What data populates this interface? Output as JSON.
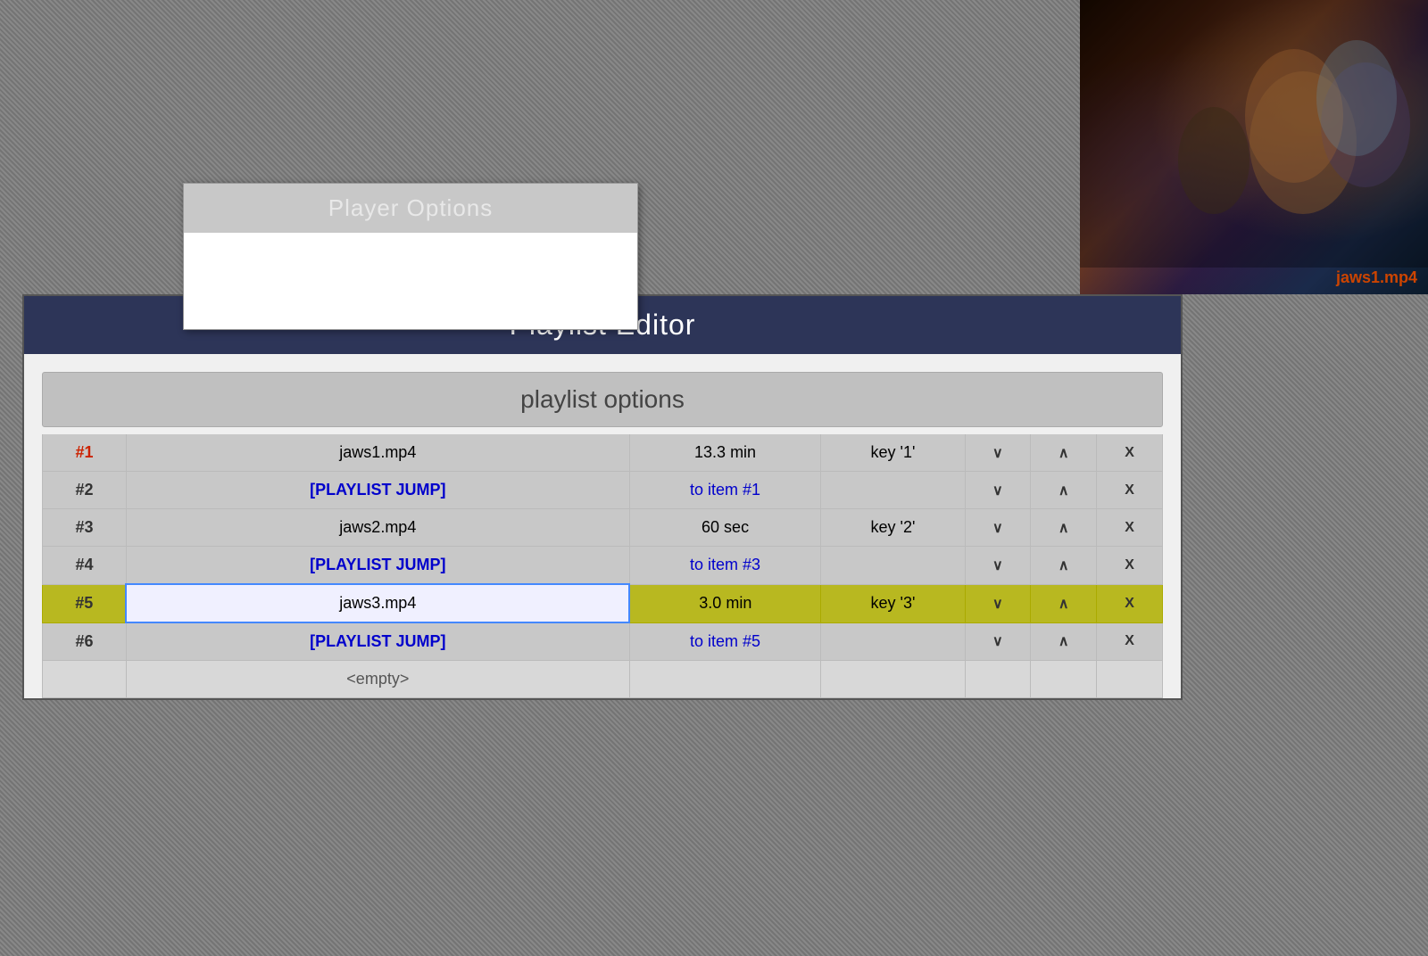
{
  "player_options": {
    "title": "Player Options"
  },
  "video_thumbnail": {
    "filename": "jaws1.mp4"
  },
  "playlist_editor": {
    "title": "Playlist Editor",
    "options_bar_label": "playlist options",
    "rows": [
      {
        "num": "#1",
        "num_class": "current",
        "filename": "jaws1.mp4",
        "filename_type": "normal",
        "duration": "13.3 min",
        "key": "key '1'",
        "selected": false
      },
      {
        "num": "#2",
        "num_class": "normal",
        "filename": "[PLAYLIST JUMP]",
        "filename_type": "jump",
        "duration": "to item #1",
        "duration_type": "jump-target",
        "key": "",
        "selected": false
      },
      {
        "num": "#3",
        "num_class": "normal",
        "filename": "jaws2.mp4",
        "filename_type": "normal",
        "duration": "60 sec",
        "key": "key '2'",
        "selected": false
      },
      {
        "num": "#4",
        "num_class": "normal",
        "filename": "[PLAYLIST JUMP]",
        "filename_type": "jump",
        "duration": "to item #3",
        "duration_type": "jump-target",
        "key": "",
        "selected": false
      },
      {
        "num": "#5",
        "num_class": "normal",
        "filename": "jaws3.mp4",
        "filename_type": "normal",
        "duration": "3.0 min",
        "key": "key '3'",
        "selected": true
      },
      {
        "num": "#6",
        "num_class": "normal",
        "filename": "[PLAYLIST JUMP]",
        "filename_type": "jump",
        "duration": "to item #5",
        "duration_type": "jump-target",
        "key": "",
        "selected": false
      }
    ],
    "empty_row": "<empty>",
    "btn_down": "∨",
    "btn_up": "∧",
    "btn_remove": "X"
  }
}
